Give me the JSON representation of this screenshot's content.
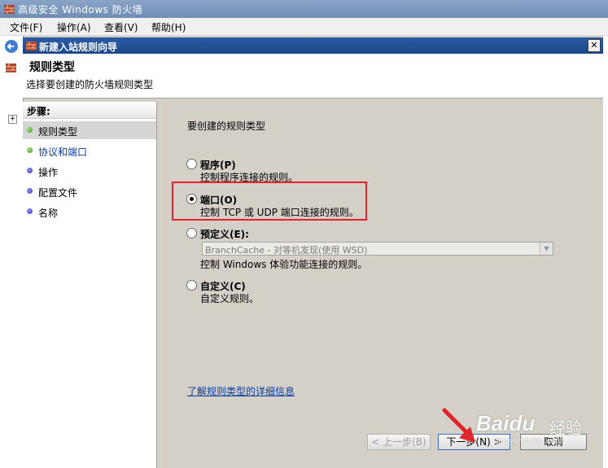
{
  "app": {
    "title": "高级安全 Windows 防火墙",
    "menu": [
      "文件(F)",
      "操作(A)",
      "查看(V)",
      "帮助(H)"
    ]
  },
  "dialog": {
    "title": "新建入站规则向导",
    "close_glyph": "✕",
    "header_title": "规则类型",
    "header_subtitle": "选择要创建的防火墙规则类型"
  },
  "steps": {
    "label": "步骤:",
    "items": [
      {
        "label": "规则类型",
        "state": "current"
      },
      {
        "label": "协议和端口",
        "state": "pending-link"
      },
      {
        "label": "操作",
        "state": "pending"
      },
      {
        "label": "配置文件",
        "state": "pending"
      },
      {
        "label": "名称",
        "state": "pending"
      }
    ]
  },
  "content": {
    "heading": "要创建的规则类型",
    "options": [
      {
        "label": "程序(P)",
        "desc": "控制程序连接的规则。",
        "checked": false
      },
      {
        "label": "端口(O)",
        "desc": "控制 TCP 或 UDP 端口连接的规则。",
        "checked": true
      },
      {
        "label": "预定义(E):",
        "desc": "控制 Windows 体验功能连接的规则。",
        "checked": false
      },
      {
        "label": "自定义(C)",
        "desc": "自定义规则。",
        "checked": false
      }
    ],
    "predefined_select_value": "BranchCache - 对等机发现(使用 WSD)",
    "learn_more_link": "了解规则类型的详细信息"
  },
  "buttons": {
    "back": "< 上一步(B)",
    "next": "下一步(N) >",
    "cancel": "取消"
  },
  "colors": {
    "highlight": "#e0242b",
    "dialog_title_bg": "#1c4889"
  },
  "watermark": {
    "brand": "Baidu",
    "jingyan": "经验",
    "url": "jingyan.baidu.com"
  }
}
